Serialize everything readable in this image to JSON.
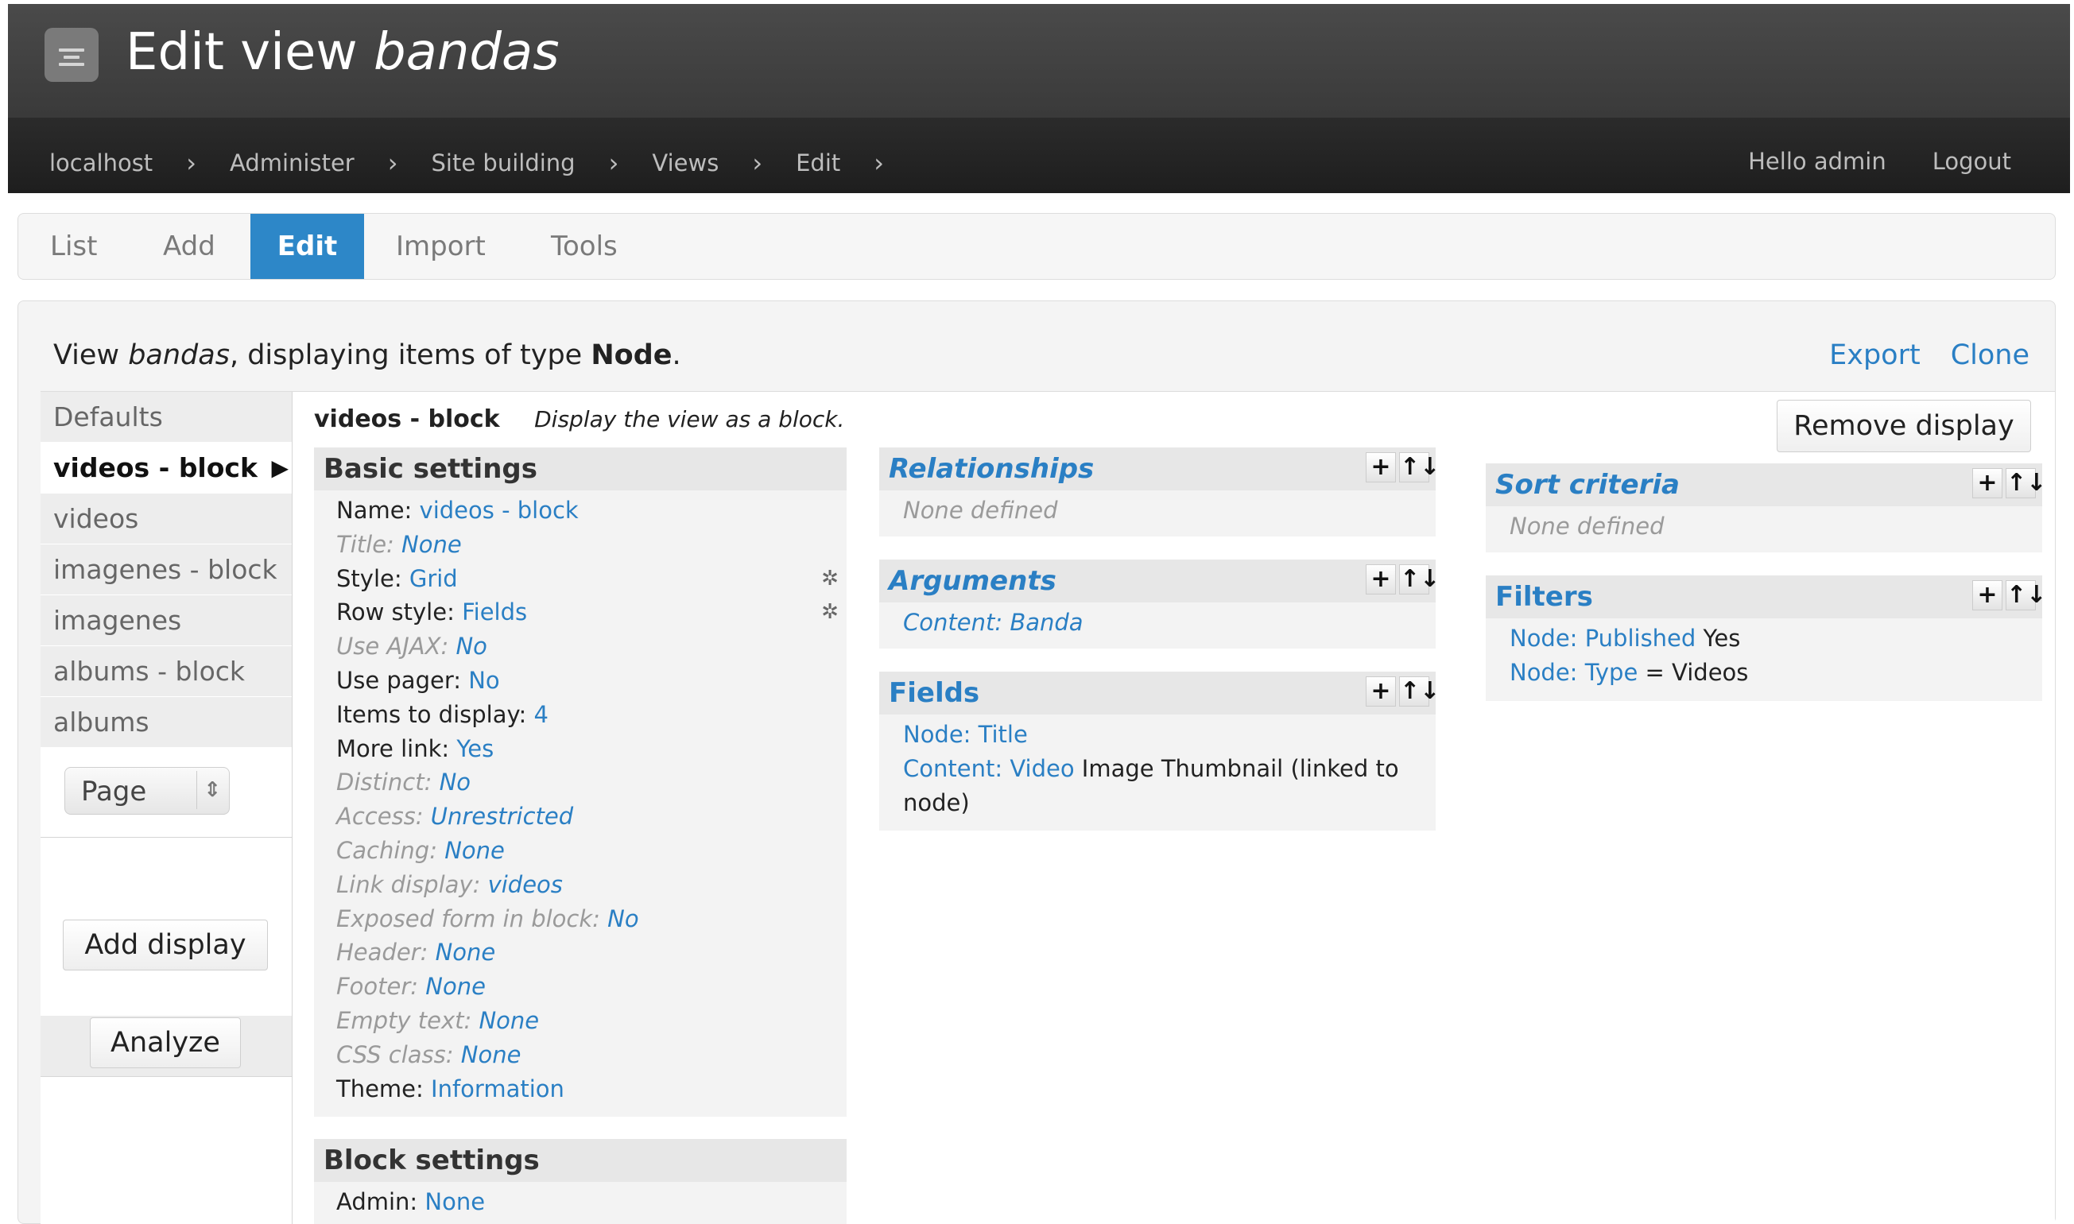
{
  "header": {
    "title_prefix": "Edit view",
    "title_view": "bandas",
    "breadcrumbs": [
      "localhost",
      "Administer",
      "Site building",
      "Views",
      "Edit"
    ],
    "greeting": "Hello admin",
    "logout": "Logout"
  },
  "tabs": [
    "List",
    "Add",
    "Edit",
    "Import",
    "Tools"
  ],
  "active_tab": "Edit",
  "summary": {
    "prefix": "View",
    "view_name": "bandas",
    "middle": ", displaying items of type",
    "type": "Node",
    "suffix": "."
  },
  "actions": {
    "export": "Export",
    "clone": "Clone",
    "remove_display": "Remove display"
  },
  "sidebar": {
    "items": [
      "Defaults",
      "videos - block",
      "videos",
      "imagenes - block",
      "imagenes",
      "albums - block",
      "albums"
    ],
    "active_item": "videos - block",
    "display_select": "Page",
    "add_display": "Add display",
    "analyze": "Analyze"
  },
  "display": {
    "name": "videos - block",
    "description": "Display the view as a block."
  },
  "basic_settings": {
    "title": "Basic settings",
    "rows": [
      {
        "label": "Name:",
        "value": "videos - block"
      },
      {
        "label": "Title:",
        "value": "None"
      },
      {
        "label": "Style:",
        "value": "Grid"
      },
      {
        "label": "Row style:",
        "value": "Fields"
      },
      {
        "label": "Use AJAX:",
        "value": "No"
      },
      {
        "label": "Use pager:",
        "value": "No"
      },
      {
        "label": "Items to display:",
        "value": "4"
      },
      {
        "label": "More link:",
        "value": "Yes"
      },
      {
        "label": "Distinct:",
        "value": "No"
      },
      {
        "label": "Access:",
        "value": "Unrestricted"
      },
      {
        "label": "Caching:",
        "value": "None"
      },
      {
        "label": "Link display:",
        "value": "videos"
      },
      {
        "label": "Exposed form in block:",
        "value": "No"
      },
      {
        "label": "Header:",
        "value": "None"
      },
      {
        "label": "Footer:",
        "value": "None"
      },
      {
        "label": "Empty text:",
        "value": "None"
      },
      {
        "label": "CSS class:",
        "value": "None"
      },
      {
        "label": "Theme:",
        "value": "Information"
      }
    ]
  },
  "block_settings": {
    "title": "Block settings",
    "rows": [
      {
        "label": "Admin:",
        "value": "None"
      }
    ]
  },
  "relationships": {
    "title": "Relationships",
    "empty": "None defined"
  },
  "arguments": {
    "title": "Arguments",
    "items": [
      "Content: Banda"
    ]
  },
  "fields": {
    "title": "Fields",
    "item1": "Node: Title",
    "item2_link": "Content: Video",
    "item2_text": "Image Thumbnail (linked to",
    "item2_cont": "node)"
  },
  "sort_criteria": {
    "title": "Sort criteria",
    "empty": "None defined"
  },
  "filters": {
    "title": "Filters",
    "f1_prefix": "Node:",
    "f1_link": "Published",
    "f1_value": "Yes",
    "f2_prefix": "Node:",
    "f2_link": "Type",
    "f2_value": "= Videos"
  },
  "icons": {
    "add": "+",
    "rearrange": "↑↓",
    "gear": "✲"
  }
}
